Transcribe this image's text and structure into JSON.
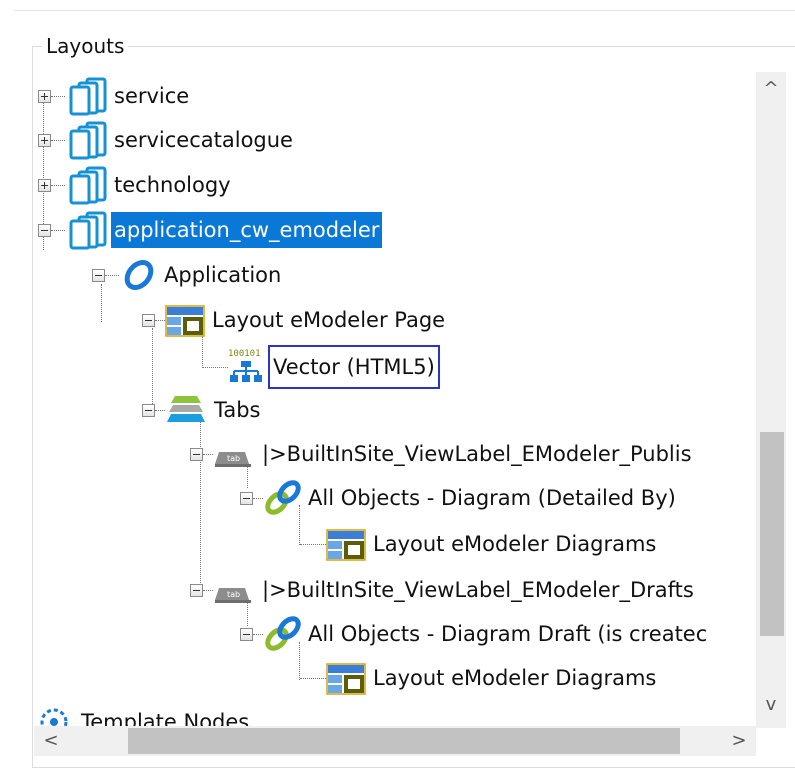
{
  "group": {
    "title": "Layouts"
  },
  "tree": {
    "nodes": [
      {
        "label": "service",
        "expander": "plus",
        "icon": "folder-stack-icon"
      },
      {
        "label": "servicecatalogue",
        "expander": "plus",
        "icon": "folder-stack-icon"
      },
      {
        "label": "technology",
        "expander": "plus",
        "icon": "folder-stack-icon"
      },
      {
        "label": "application_cw_emodeler",
        "expander": "minus",
        "icon": "folder-stack-icon",
        "selected": true
      },
      {
        "label": "Application",
        "expander": "minus",
        "icon": "ring-icon"
      },
      {
        "label": "Layout eModeler Page",
        "expander": "minus",
        "icon": "layout-icon"
      },
      {
        "label": "Vector (HTML5)",
        "expander": "none",
        "icon": "binary-hierarchy-icon",
        "boxed": true
      },
      {
        "label": "Tabs",
        "expander": "minus",
        "icon": "tabs-stack-icon"
      },
      {
        "label": "|>BuiltInSite_ViewLabel_EModeler_Publis",
        "expander": "minus",
        "icon": "tab-icon",
        "icon_text": "tab"
      },
      {
        "label": "All Objects - Diagram (Detailed By)",
        "expander": "minus",
        "icon": "link-icon"
      },
      {
        "label": "Layout eModeler Diagrams",
        "expander": "none",
        "icon": "layout-icon"
      },
      {
        "label": "|>BuiltInSite_ViewLabel_EModeler_Drafts",
        "expander": "minus",
        "icon": "tab-icon",
        "icon_text": "tab"
      },
      {
        "label": "All Objects - Diagram Draft (is createc",
        "expander": "minus",
        "icon": "link-icon"
      },
      {
        "label": "Layout eModeler Diagrams",
        "expander": "none",
        "icon": "layout-icon"
      },
      {
        "label": "Template Nodes",
        "expander": "none",
        "icon": "template-icon"
      }
    ]
  },
  "scrollbars": {
    "up": "^",
    "down": "v",
    "left": "<",
    "right": ">"
  },
  "colors": {
    "selection": "#0a78d7",
    "highlight_box": "#2c34c4",
    "folder": "#1592d4",
    "ring": "#1a78d6",
    "link_green": "#8dbb2d"
  }
}
